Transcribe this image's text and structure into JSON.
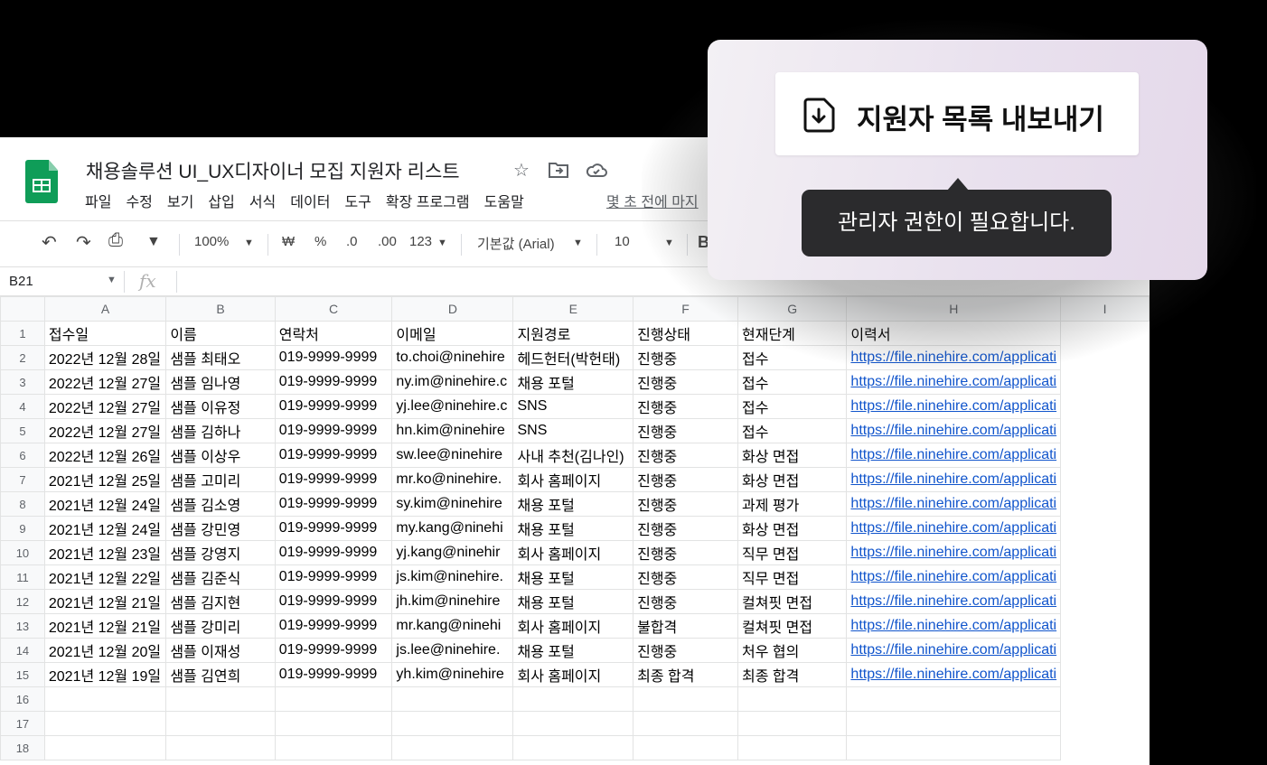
{
  "doc": {
    "title": "채용솔루션 UI_UX디자이너 모집 지원자 리스트",
    "title_icons": [
      "star-icon",
      "move-folder-icon",
      "cloud-status-icon"
    ]
  },
  "menu": [
    "파일",
    "수정",
    "보기",
    "삽입",
    "서식",
    "데이터",
    "도구",
    "확장 프로그램",
    "도움말"
  ],
  "last_edit": "몇 초 전에 마지",
  "toolbar": {
    "undo": "↶",
    "redo": "↷",
    "print": "⎙",
    "paint": "▼",
    "zoom": "100%",
    "currency": "₩",
    "percent": "%",
    "dec_decrease": ".0",
    "dec_increase": ".00",
    "more_formats": "123",
    "font": "기본값 (Arial)",
    "font_size": "10",
    "bold": "B"
  },
  "formula_bar": {
    "cell_ref": "B21",
    "fx": "fx"
  },
  "columns": [
    "A",
    "B",
    "C",
    "D",
    "E",
    "F",
    "G",
    "H",
    "I"
  ],
  "rows": [
    [
      "1",
      "접수일",
      "이름",
      "연락처",
      "이메일",
      "지원경로",
      "진행상태",
      "현재단계",
      "이력서"
    ],
    [
      "2",
      "2022년 12월 28일",
      "샘플 최태오",
      "019-9999-9999",
      "to.choi@ninehire",
      "헤드헌터(박헌태)",
      "진행중",
      "접수",
      "https://file.ninehire.com/applicati"
    ],
    [
      "3",
      "2022년 12월 27일",
      "샘플 임나영",
      "019-9999-9999",
      "ny.im@ninehire.c",
      "채용 포털",
      "진행중",
      "접수",
      "https://file.ninehire.com/applicati"
    ],
    [
      "4",
      "2022년 12월 27일",
      "샘플 이유정",
      "019-9999-9999",
      "yj.lee@ninehire.c",
      "SNS",
      "진행중",
      "접수",
      "https://file.ninehire.com/applicati"
    ],
    [
      "5",
      "2022년 12월 27일",
      "샘플 김하나",
      "019-9999-9999",
      "hn.kim@ninehire",
      "SNS",
      "진행중",
      "접수",
      "https://file.ninehire.com/applicati"
    ],
    [
      "6",
      "2022년 12월 26일",
      "샘플 이상우",
      "019-9999-9999",
      "sw.lee@ninehire",
      "사내 추천(김나인)",
      "진행중",
      "화상 면접",
      "https://file.ninehire.com/applicati"
    ],
    [
      "7",
      "2021년 12월 25일",
      "샘플 고미리",
      "019-9999-9999",
      "mr.ko@ninehire.",
      "회사 홈페이지",
      "진행중",
      "화상 면접",
      "https://file.ninehire.com/applicati"
    ],
    [
      "8",
      "2021년 12월 24일",
      "샘플 김소영",
      "019-9999-9999",
      "sy.kim@ninehire",
      "채용 포털",
      "진행중",
      "과제 평가",
      "https://file.ninehire.com/applicati"
    ],
    [
      "9",
      "2021년 12월 24일",
      "샘플 강민영",
      "019-9999-9999",
      "my.kang@ninehi",
      "채용 포털",
      "진행중",
      "화상 면접",
      "https://file.ninehire.com/applicati"
    ],
    [
      "10",
      "2021년 12월 23일",
      "샘플 강영지",
      "019-9999-9999",
      "yj.kang@ninehir",
      "회사 홈페이지",
      "진행중",
      "직무 면접",
      "https://file.ninehire.com/applicati"
    ],
    [
      "11",
      "2021년 12월 22일",
      "샘플 김준식",
      "019-9999-9999",
      "js.kim@ninehire.",
      "채용 포털",
      "진행중",
      "직무 면접",
      "https://file.ninehire.com/applicati"
    ],
    [
      "12",
      "2021년 12월 21일",
      "샘플 김지현",
      "019-9999-9999",
      "jh.kim@ninehire",
      "채용 포털",
      "진행중",
      "컬쳐핏 면접",
      "https://file.ninehire.com/applicati"
    ],
    [
      "13",
      "2021년 12월 21일",
      "샘플 강미리",
      "019-9999-9999",
      "mr.kang@ninehi",
      "회사 홈페이지",
      "불합격",
      "컬쳐핏 면접",
      "https://file.ninehire.com/applicati"
    ],
    [
      "14",
      "2021년 12월 20일",
      "샘플 이재성",
      "019-9999-9999",
      "js.lee@ninehire.",
      "채용 포털",
      "진행중",
      "처우 협의",
      "https://file.ninehire.com/applicati"
    ],
    [
      "15",
      "2021년 12월 19일",
      "샘플 김연희",
      "019-9999-9999",
      "yh.kim@ninehire",
      "회사 홈페이지",
      "최종 합격",
      "최종 합격",
      "https://file.ninehire.com/applicati"
    ],
    [
      "16",
      "",
      "",
      "",
      "",
      "",
      "",
      "",
      ""
    ],
    [
      "17",
      "",
      "",
      "",
      "",
      "",
      "",
      "",
      ""
    ],
    [
      "18",
      "",
      "",
      "",
      "",
      "",
      "",
      "",
      ""
    ]
  ],
  "export": {
    "label": "지원자 목록 내보내기",
    "icon": "download-file-icon"
  },
  "tooltip": "관리자 권한이 필요합니다."
}
